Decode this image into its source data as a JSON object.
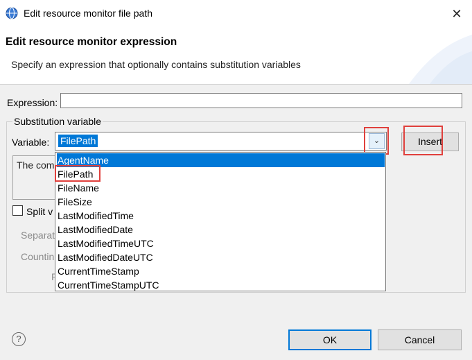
{
  "window": {
    "title": "Edit resource monitor file path",
    "close_icon": "close-icon",
    "app_icon": "globe-icon"
  },
  "header": {
    "title": "Edit resource monitor expression",
    "description": "Specify an expression that optionally contains substitution variables"
  },
  "expression": {
    "label": "Expression:",
    "value": ""
  },
  "substitution": {
    "group_label": "Substitution variable",
    "variable_label": "Variable:",
    "selected_value": "FilePath",
    "insert_label": "Insert",
    "description_partial": "The com",
    "split_label": "Split v",
    "separator_label": "Separat",
    "counting_label": "Countin",
    "p_label": "P",
    "options": [
      "AgentName",
      "FilePath",
      "FileName",
      "FileSize",
      "LastModifiedTime",
      "LastModifiedDate",
      "LastModifiedTimeUTC",
      "LastModifiedDateUTC",
      "CurrentTimeStamp",
      "CurrentTimeStampUTC"
    ],
    "highlighted_option": "AgentName"
  },
  "footer": {
    "help_icon": "help-icon",
    "help_glyph": "?",
    "ok_label": "OK",
    "cancel_label": "Cancel"
  },
  "colors": {
    "selection": "#0078d7",
    "annotation_highlight": "#e0403c"
  }
}
